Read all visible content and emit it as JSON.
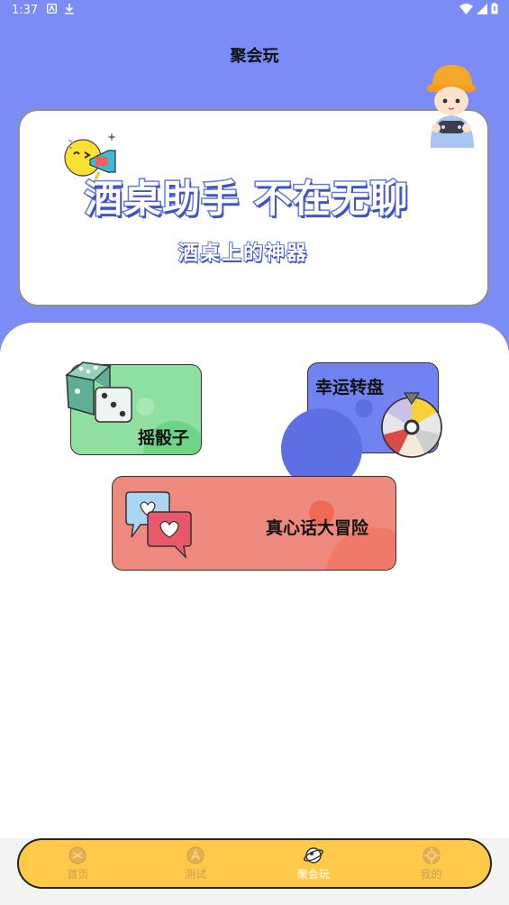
{
  "status_bar": {
    "time": "1:37"
  },
  "header": {
    "title": "聚会玩"
  },
  "banner": {
    "headline": "酒桌助手 不在无聊",
    "subtitle": "酒桌上的神器"
  },
  "games": [
    {
      "label": "摇骰子"
    },
    {
      "label": "幸运转盘"
    },
    {
      "label": "真心话大冒险"
    }
  ],
  "bottom_nav": {
    "items": [
      {
        "label": "首页",
        "icon": "home-icon"
      },
      {
        "label": "测试",
        "icon": "test-icon"
      },
      {
        "label": "聚会玩",
        "icon": "party-icon",
        "active": true
      },
      {
        "label": "我的",
        "icon": "profile-icon"
      }
    ]
  },
  "colors": {
    "header_bg": "#7b8cf6",
    "nav_bg": "#ffc94a",
    "dice_card": "#8fe0a0",
    "wheel_card": "#6f83f2",
    "truth_card": "#ee8a7d"
  }
}
